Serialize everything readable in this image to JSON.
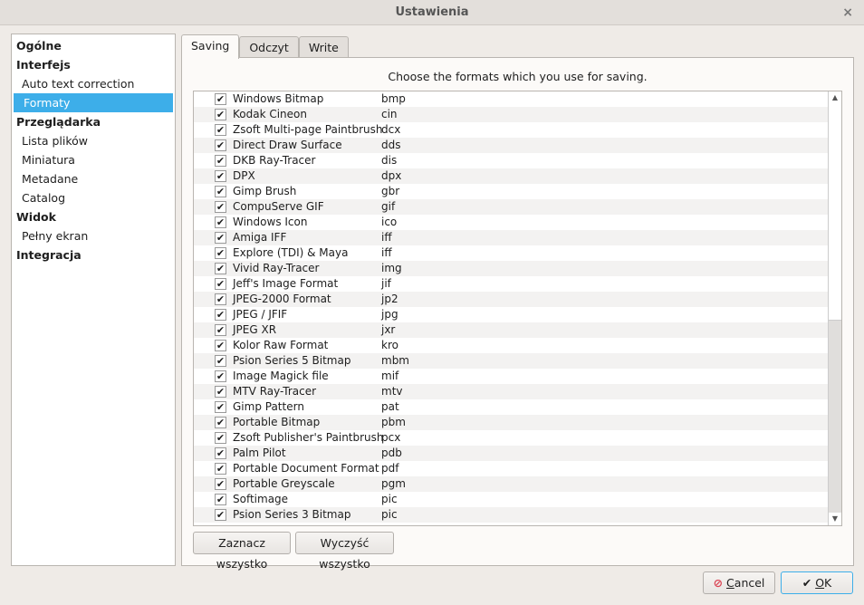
{
  "window": {
    "title": "Ustawienia",
    "close_icon": "×"
  },
  "sidebar": {
    "items": [
      {
        "label": "Ogólne",
        "type": "cat"
      },
      {
        "label": "Interfejs",
        "type": "cat"
      },
      {
        "label": "Auto text correction",
        "type": "sub"
      },
      {
        "label": "Formaty",
        "type": "sub",
        "selected": true
      },
      {
        "label": "Przeglądarka",
        "type": "cat"
      },
      {
        "label": "Lista plików",
        "type": "sub"
      },
      {
        "label": "Miniatura",
        "type": "sub"
      },
      {
        "label": "Metadane",
        "type": "sub"
      },
      {
        "label": "Catalog",
        "type": "sub"
      },
      {
        "label": "Widok",
        "type": "cat"
      },
      {
        "label": "Pełny ekran",
        "type": "sub"
      },
      {
        "label": "Integracja",
        "type": "cat"
      }
    ]
  },
  "tabs": [
    "Saving",
    "Odczyt",
    "Write"
  ],
  "hint": "Choose the formats which you use for saving.",
  "formats": [
    [
      "Windows Bitmap",
      "bmp"
    ],
    [
      "Kodak Cineon",
      "cin"
    ],
    [
      "Zsoft Multi-page Paintbrush",
      "dcx"
    ],
    [
      "Direct Draw Surface",
      "dds"
    ],
    [
      "DKB Ray-Tracer",
      "dis"
    ],
    [
      "DPX",
      "dpx"
    ],
    [
      "Gimp Brush",
      "gbr"
    ],
    [
      "CompuServe GIF",
      "gif"
    ],
    [
      "Windows Icon",
      "ico"
    ],
    [
      "Amiga IFF",
      "iff"
    ],
    [
      "Explore (TDI) & Maya",
      "iff"
    ],
    [
      "Vivid Ray-Tracer",
      "img"
    ],
    [
      "Jeff's Image Format",
      "jif"
    ],
    [
      "JPEG-2000 Format",
      "jp2"
    ],
    [
      "JPEG / JFIF",
      "jpg"
    ],
    [
      "JPEG XR",
      "jxr"
    ],
    [
      "Kolor Raw Format",
      "kro"
    ],
    [
      "Psion Series 5 Bitmap",
      "mbm"
    ],
    [
      "Image Magick file",
      "mif"
    ],
    [
      "MTV Ray-Tracer",
      "mtv"
    ],
    [
      "Gimp Pattern",
      "pat"
    ],
    [
      "Portable Bitmap",
      "pbm"
    ],
    [
      "Zsoft Publisher's Paintbrush",
      "pcx"
    ],
    [
      "Palm Pilot",
      "pdb"
    ],
    [
      "Portable Document Format",
      "pdf"
    ],
    [
      "Portable Greyscale",
      "pgm"
    ],
    [
      "Softimage",
      "pic"
    ],
    [
      "Psion Series 3 Bitmap",
      "pic"
    ]
  ],
  "check_mark": "✔",
  "buttons": {
    "select_all": "Zaznacz wszystko",
    "clear_all": "Wyczyść wszystko",
    "cancel_u": "C",
    "cancel_rest": "ancel",
    "ok_u": "O",
    "ok_rest": "K"
  }
}
